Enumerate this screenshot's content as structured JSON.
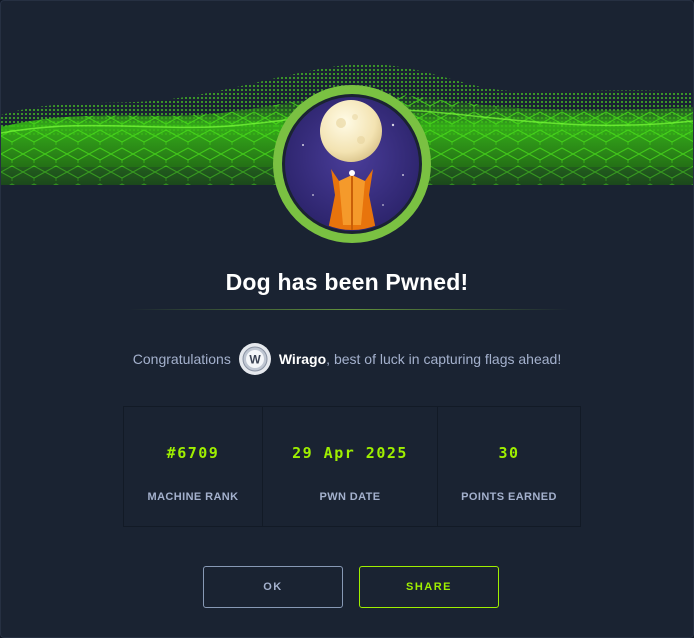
{
  "title": "Dog has been Pwned!",
  "congrats": {
    "prefix": "Congratulations",
    "username": "Wirago",
    "suffix": ", best of luck in capturing flags ahead!",
    "avatar_letter": "W"
  },
  "stats": [
    {
      "value": "#6709",
      "label": "MACHINE RANK"
    },
    {
      "value": "29 Apr 2025",
      "label": "PWN DATE"
    },
    {
      "value": "30",
      "label": "POINTS EARNED"
    }
  ],
  "buttons": {
    "ok": "OK",
    "share": "SHARE"
  },
  "colors": {
    "accent": "#9fef00",
    "background": "#1a2332",
    "text_muted": "#a4b1cd"
  },
  "icons": {
    "banner": "green-wave-grid-banner",
    "badge": "machine-badge-dog-moon",
    "avatar": "user-avatar-w"
  }
}
